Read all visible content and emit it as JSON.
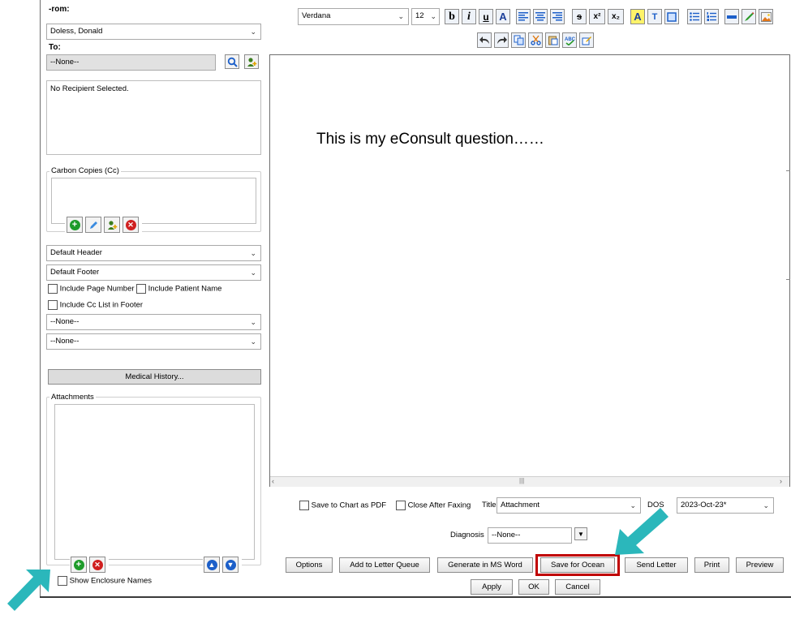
{
  "left": {
    "from_label": "-rom:",
    "from_value": "Doless, Donald",
    "to_label": "To:",
    "to_value": "--None--",
    "recipient_text": "No Recipient Selected.",
    "cc_label": "Carbon Copies (Cc)",
    "header_select": "Default Header",
    "footer_select": "Default Footer",
    "include_page_number": "Include Page Number",
    "include_patient_name": "Include Patient Name",
    "include_cc_list": "Include Cc List in Footer",
    "select_none_1": "--None--",
    "select_none_2": "--None--",
    "medical_history_button": "Medical History...",
    "attachments_label": "Attachments",
    "show_enclosure_names": "Show Enclosure Names"
  },
  "toolbar": {
    "font_name": "Verdana",
    "font_size": "12",
    "bold": "b",
    "italic": "i",
    "underline": "u",
    "font_color": "A",
    "strike": "s",
    "superscript": "x²",
    "subscript": "x₂",
    "highlight": "A",
    "textbox": "T"
  },
  "editor": {
    "content": "This is my eConsult question……"
  },
  "bottom": {
    "save_pdf_label": "Save to Chart as PDF",
    "close_after_faxing_label": "Close After Faxing",
    "title_label": "Title",
    "title_value": "Attachment",
    "dos_label": "DOS",
    "dos_value": "2023-Oct-23*",
    "diagnosis_label": "Diagnosis",
    "diagnosis_value": "--None--",
    "buttons": {
      "options": "Options",
      "add_to_letter_queue": "Add to Letter Queue",
      "generate_ms_word": "Generate in MS Word",
      "save_for_ocean": "Save for Ocean",
      "send_letter": "Send Letter",
      "print": "Print",
      "preview": "Preview",
      "apply": "Apply",
      "ok": "OK",
      "cancel": "Cancel"
    }
  },
  "colors": {
    "annotation_arrow": "#2bb7bb",
    "highlight_box": "#c00000",
    "add_green": "#1e9b2a",
    "remove_red": "#d01f1f",
    "nav_blue": "#1c5fc9"
  }
}
